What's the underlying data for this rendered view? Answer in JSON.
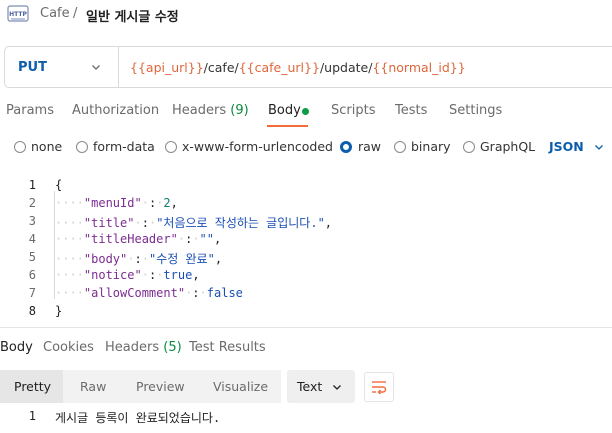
{
  "header": {
    "icon": "http-icon",
    "breadcrumb_parent": "Cafe",
    "breadcrumb_sep": "/",
    "title": "일반 게시글 수정"
  },
  "request": {
    "method": "PUT",
    "url_parts": [
      {
        "text": "{{api_url}}",
        "kind": "var"
      },
      {
        "text": "/cafe/",
        "kind": "text"
      },
      {
        "text": "{{cafe_url}}",
        "kind": "var"
      },
      {
        "text": "/update/",
        "kind": "text"
      },
      {
        "text": "{{normal_id}}",
        "kind": "var"
      }
    ]
  },
  "request_tabs": {
    "params": "Params",
    "authorization": "Authorization",
    "headers": "Headers",
    "headers_count": "(9)",
    "body": "Body",
    "scripts": "Scripts",
    "tests": "Tests",
    "settings": "Settings"
  },
  "body_types": {
    "none": "none",
    "form_data": "form-data",
    "urlencoded": "x-www-form-urlencoded",
    "raw": "raw",
    "binary": "binary",
    "graphql": "GraphQL",
    "selected": "raw",
    "language": "JSON"
  },
  "code": {
    "line_numbers": [
      "1",
      "2",
      "3",
      "4",
      "5",
      "6",
      "7",
      "8"
    ],
    "lines": [
      [
        {
          "t": "{",
          "c": "p"
        }
      ],
      [
        {
          "t": "····",
          "c": "ws"
        },
        {
          "t": "\"menuId\"",
          "c": "key"
        },
        {
          "t": "·",
          "c": "ws"
        },
        {
          "t": ":",
          "c": "p"
        },
        {
          "t": "·",
          "c": "ws"
        },
        {
          "t": "2",
          "c": "num"
        },
        {
          "t": ",",
          "c": "p"
        }
      ],
      [
        {
          "t": "····",
          "c": "ws"
        },
        {
          "t": "\"title\"",
          "c": "key"
        },
        {
          "t": "·",
          "c": "ws"
        },
        {
          "t": ":",
          "c": "p"
        },
        {
          "t": "·",
          "c": "ws"
        },
        {
          "t": "\"처음으로 작성하는 글입니다.\"",
          "c": "str"
        },
        {
          "t": ",",
          "c": "p"
        }
      ],
      [
        {
          "t": "····",
          "c": "ws"
        },
        {
          "t": "\"titleHeader\"",
          "c": "key"
        },
        {
          "t": "·",
          "c": "ws"
        },
        {
          "t": ":",
          "c": "p"
        },
        {
          "t": "·",
          "c": "ws"
        },
        {
          "t": "\"\"",
          "c": "str"
        },
        {
          "t": ",",
          "c": "p"
        }
      ],
      [
        {
          "t": "····",
          "c": "ws"
        },
        {
          "t": "\"body\"",
          "c": "key"
        },
        {
          "t": "·",
          "c": "ws"
        },
        {
          "t": ":",
          "c": "p"
        },
        {
          "t": "·",
          "c": "ws"
        },
        {
          "t": "\"수정 완료\"",
          "c": "str"
        },
        {
          "t": ",",
          "c": "p"
        }
      ],
      [
        {
          "t": "····",
          "c": "ws"
        },
        {
          "t": "\"notice\"",
          "c": "key"
        },
        {
          "t": "·",
          "c": "ws"
        },
        {
          "t": ":",
          "c": "p"
        },
        {
          "t": "·",
          "c": "ws"
        },
        {
          "t": "true",
          "c": "kw"
        },
        {
          "t": ",",
          "c": "p"
        }
      ],
      [
        {
          "t": "····",
          "c": "ws"
        },
        {
          "t": "\"allowComment\"",
          "c": "key"
        },
        {
          "t": "·",
          "c": "ws"
        },
        {
          "t": ":",
          "c": "p"
        },
        {
          "t": "·",
          "c": "ws"
        },
        {
          "t": "false",
          "c": "kw"
        }
      ],
      [
        {
          "t": "}",
          "c": "p"
        }
      ]
    ]
  },
  "response_tabs": {
    "body": "Body",
    "cookies": "Cookies",
    "headers": "Headers",
    "headers_count": "(5)",
    "test_results": "Test Results"
  },
  "response_view": {
    "pretty": "Pretty",
    "raw": "Raw",
    "preview": "Preview",
    "visualize": "Visualize",
    "format": "Text"
  },
  "response_body": {
    "line_number": "1",
    "text": "게시글 등록이 완료되었습니다."
  },
  "colors": {
    "accent": "#f26b3a",
    "method": "#0b5eab",
    "variable": "#e0673b"
  }
}
